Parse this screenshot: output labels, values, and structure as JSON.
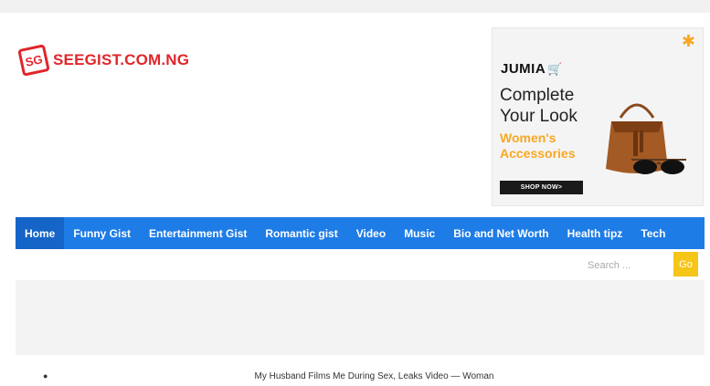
{
  "site": {
    "logo_mark": "SG",
    "logo_text": "SEEGIST.COM.NG"
  },
  "ad": {
    "brand": "JUMIA",
    "headline": "Complete Your Look",
    "subline": "Women's Accessories",
    "cta": "SHOP NOW>",
    "colors": {
      "accent": "#f7a823",
      "cta_bg": "#1a1a1a"
    }
  },
  "nav": {
    "color": "#1e7ce6",
    "items": [
      {
        "label": "Home",
        "active": true
      },
      {
        "label": "Funny Gist"
      },
      {
        "label": "Entertainment Gist"
      },
      {
        "label": "Romantic gist"
      },
      {
        "label": "Video"
      },
      {
        "label": "Music"
      },
      {
        "label": "Bio and Net Worth"
      },
      {
        "label": "Health tipz"
      },
      {
        "label": "Tech"
      }
    ]
  },
  "search": {
    "placeholder": "Search ...",
    "button_label": "Go"
  },
  "ticker": {
    "headline": "My Husband Films Me During Sex, Leaks Video — Woman"
  }
}
